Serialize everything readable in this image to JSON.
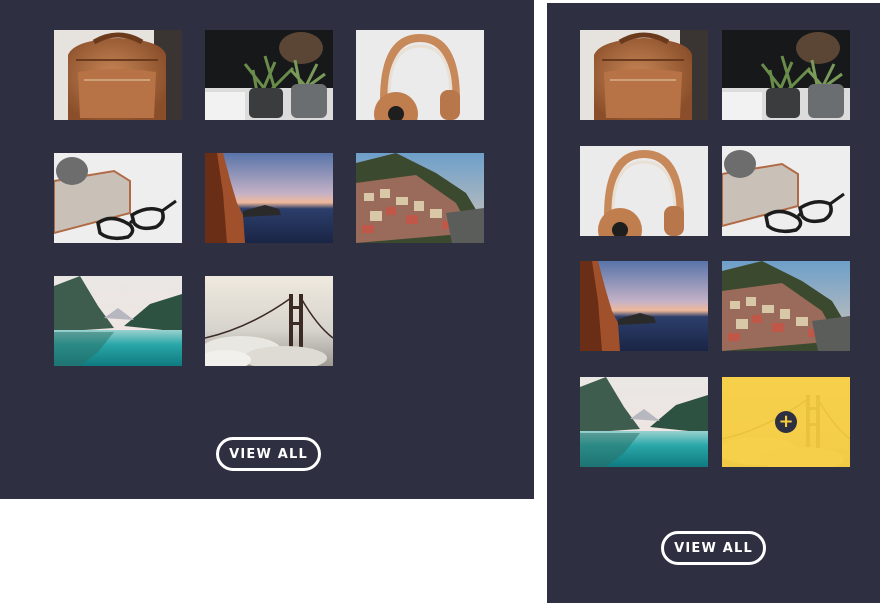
{
  "gallery": {
    "view_all_label": "VIEW ALL",
    "images": [
      {
        "id": "backpack",
        "subject": "leather backpack"
      },
      {
        "id": "plants",
        "subject": "potted plants"
      },
      {
        "id": "headphones",
        "subject": "headphones"
      },
      {
        "id": "glasses",
        "subject": "glasses and glass box"
      },
      {
        "id": "cliff",
        "subject": "sea cliff at dusk"
      },
      {
        "id": "village",
        "subject": "cliffside village"
      },
      {
        "id": "lake",
        "subject": "mountain lake"
      },
      {
        "id": "bridge",
        "subject": "golden gate bridge in fog"
      }
    ]
  },
  "colors": {
    "panel_bg": "#2e3042",
    "accent": "#f7cd3f",
    "button_border": "#ffffff"
  },
  "icons": {
    "hover_icon": "plus-icon",
    "hover_glyph": "+"
  }
}
